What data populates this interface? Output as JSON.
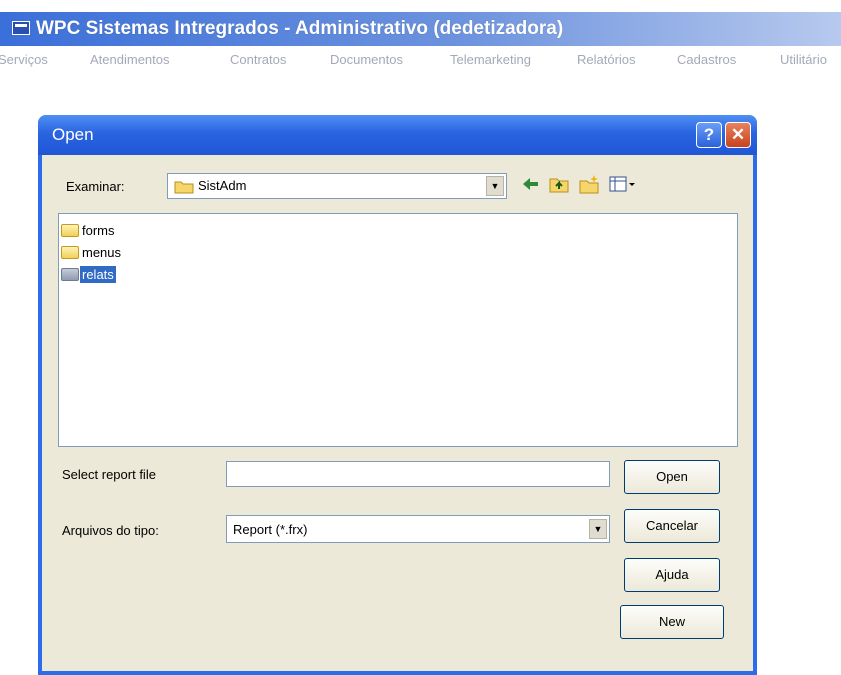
{
  "app": {
    "title": "WPC Sistemas Intregrados - Administrativo (dedetizadora)"
  },
  "menu": {
    "items": [
      "Serviços",
      "Atendimentos",
      "Contratos",
      "Documentos",
      "Telemarketing",
      "Relatórios",
      "Cadastros",
      "Utilitário"
    ]
  },
  "dialog": {
    "title": "Open",
    "help_label": "?",
    "close_label": "✕",
    "lookin_label": "Examinar:",
    "lookin_value": "SistAdm",
    "files": [
      {
        "name": "forms",
        "selected": false
      },
      {
        "name": "menus",
        "selected": false
      },
      {
        "name": "relats",
        "selected": true
      }
    ],
    "filename_label": "Select report file",
    "filename_value": "",
    "filetype_label": "Arquivos do tipo:",
    "filetype_value": "Report (*.frx)",
    "buttons": {
      "open": "Open",
      "cancel": "Cancelar",
      "help": "Ajuda",
      "new": "New"
    }
  },
  "colors": {
    "titlebar": "#2a64e0",
    "dialog_bg": "#ece9d8",
    "selection": "#316ac5"
  }
}
